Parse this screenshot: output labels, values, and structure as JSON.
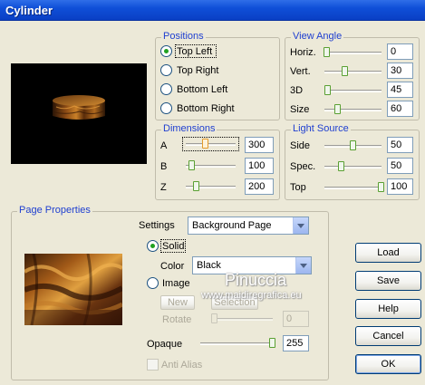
{
  "window": {
    "title": "Cylinder"
  },
  "positions": {
    "label": "Positions",
    "options": [
      {
        "label": "Top Left",
        "checked": true
      },
      {
        "label": "Top Right",
        "checked": false
      },
      {
        "label": "Bottom Left",
        "checked": false
      },
      {
        "label": "Bottom Right",
        "checked": false
      }
    ]
  },
  "view_angle": {
    "label": "View Angle",
    "rows": [
      {
        "label": "Horiz.",
        "value": "0"
      },
      {
        "label": "Vert.",
        "value": "30"
      },
      {
        "label": "3D",
        "value": "45"
      },
      {
        "label": "Size",
        "value": "60"
      }
    ]
  },
  "dimensions": {
    "label": "Dimensions",
    "rows": [
      {
        "label": "A",
        "value": "300"
      },
      {
        "label": "B",
        "value": "100"
      },
      {
        "label": "Z",
        "value": "200"
      }
    ]
  },
  "light_source": {
    "label": "Light Source",
    "rows": [
      {
        "label": "Side",
        "value": "50"
      },
      {
        "label": "Spec.",
        "value": "50"
      },
      {
        "label": "Top",
        "value": "100"
      }
    ]
  },
  "page_properties": {
    "label": "Page Properties",
    "settings_label": "Settings",
    "settings_value": "Background Page",
    "solid_label": "Solid",
    "solid_checked": true,
    "color_label": "Color",
    "color_value": "Black",
    "image_label": "Image",
    "image_checked": false,
    "new_label": "New",
    "selection_label": "Selection",
    "rotate_label": "Rotate",
    "rotate_value": "0",
    "opaque_label": "Opaque",
    "opaque_value": "255",
    "anti_alias_label": "Anti Alias",
    "anti_alias_checked": false
  },
  "buttons": {
    "load": "Load",
    "save": "Save",
    "help": "Help",
    "cancel": "Cancel",
    "ok": "OK"
  },
  "watermark": {
    "name": "Pinuccia",
    "url": "www.maidiregrafica.eu"
  },
  "colors": {
    "title_bar": "#0f4fd8",
    "group_label": "#1f3fd0",
    "dialog_bg": "#ece9d8",
    "radio_dot": "#21a121"
  }
}
